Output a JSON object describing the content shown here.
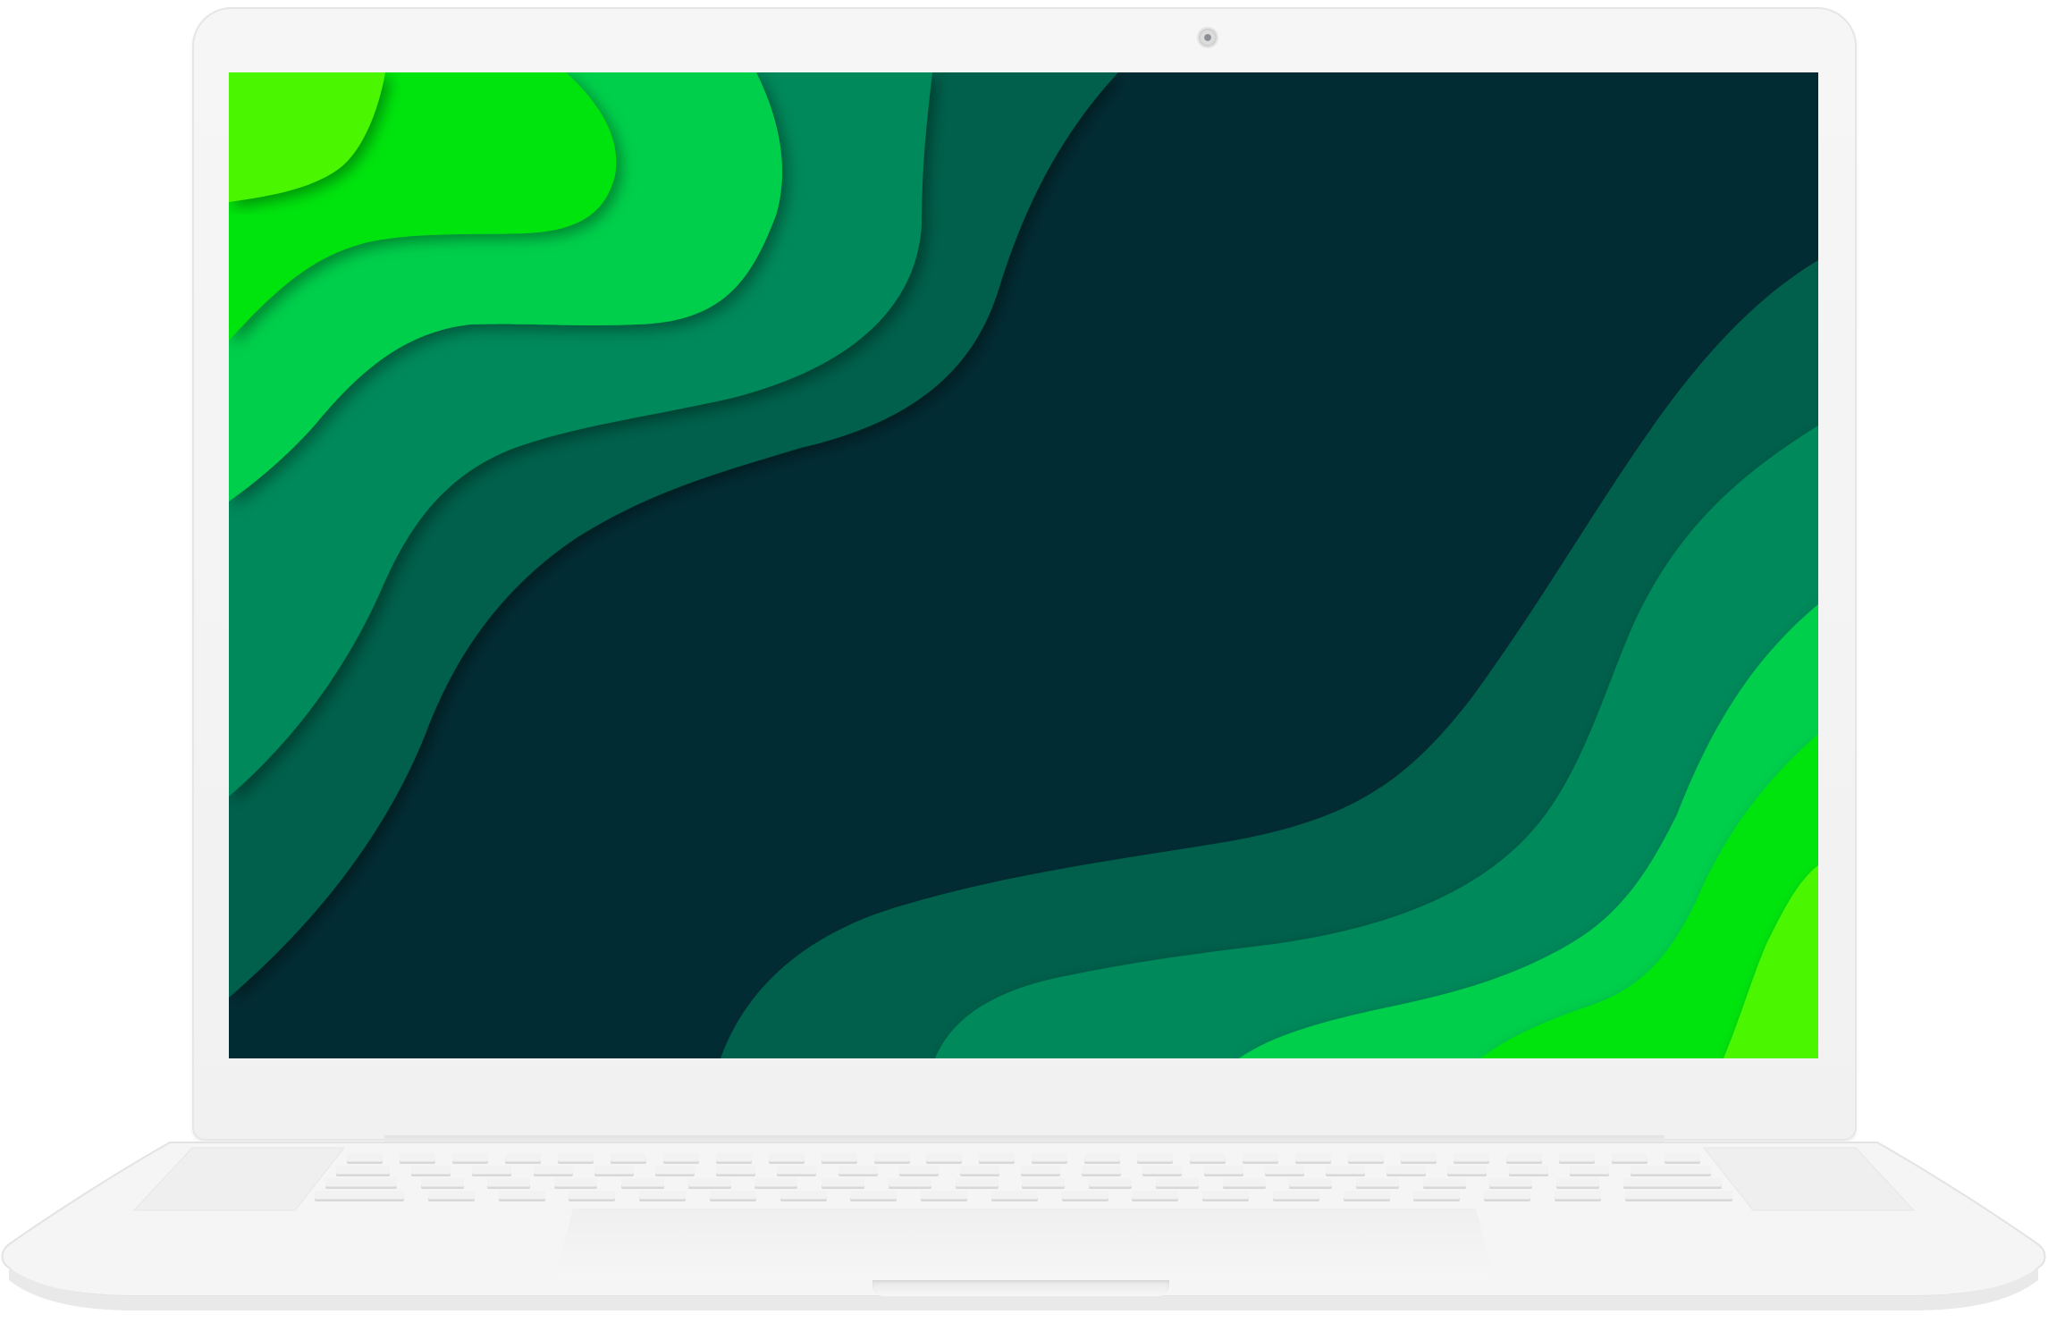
{
  "device": {
    "type": "laptop",
    "color": "#f4f4f4"
  },
  "screen": {
    "wallpaper": "green-layered-waves",
    "colors": {
      "lime": "#4cf700",
      "bright_green": "#03e40a",
      "green": "#02cf4b",
      "mid_green": "#02895a",
      "dark_green": "#02604b",
      "deep": "#022c34"
    }
  }
}
